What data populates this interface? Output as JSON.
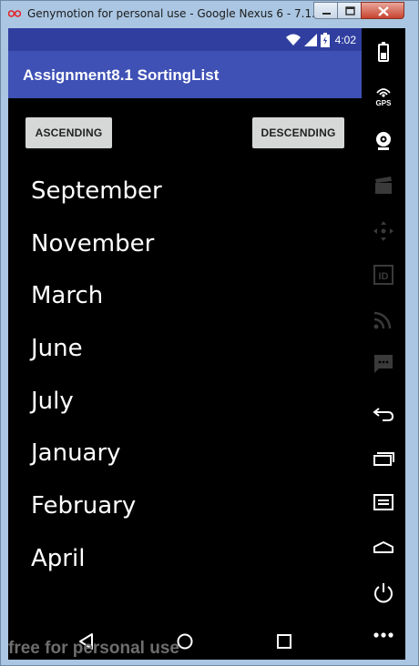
{
  "window": {
    "title": "Genymotion for personal use - Google Nexus 6 - 7.1.0 - ..."
  },
  "status_bar": {
    "time": "4:02"
  },
  "app_bar": {
    "title": "Assignment8.1 SortingList"
  },
  "buttons": {
    "ascending": "ASCENDING",
    "descending": "DESCENDING"
  },
  "months": [
    "September",
    "November",
    "March",
    "June",
    "July",
    "January",
    "February",
    "April"
  ],
  "watermark": "free for personal use",
  "side_panel": {
    "gps_label": "GPS",
    "id_label": "ID"
  },
  "colors": {
    "status_bar": "#303f9f",
    "app_bar": "#3f51b5",
    "background": "#000000",
    "button": "#d6d7d7"
  }
}
